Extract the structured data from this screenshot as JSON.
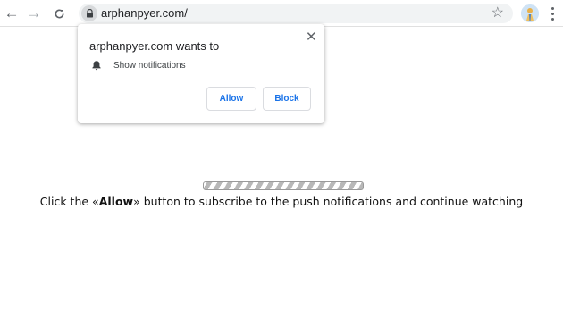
{
  "browser": {
    "url": "arphanpyer.com/"
  },
  "popup": {
    "title": "arphanpyer.com wants to",
    "permission_label": "Show notifications",
    "allow_label": "Allow",
    "block_label": "Block",
    "close_glyph": "✕"
  },
  "page": {
    "message_before": "Click the «",
    "message_bold": "Allow",
    "message_after": "» button to subscribe to the push notifications and continue watching"
  },
  "icons": {
    "back": "arrow-left-icon",
    "forward": "arrow-right-icon",
    "reload": "reload-icon",
    "lock": "lock-icon",
    "bookmark": "star-icon",
    "profile": "avatar",
    "menu": "kebab-menu-icon",
    "notification": "bell-icon",
    "close": "close-icon"
  },
  "colors": {
    "accent": "#1a73e8",
    "omnibox_bg": "#f1f3f4",
    "icon_gray": "#5f6368"
  }
}
